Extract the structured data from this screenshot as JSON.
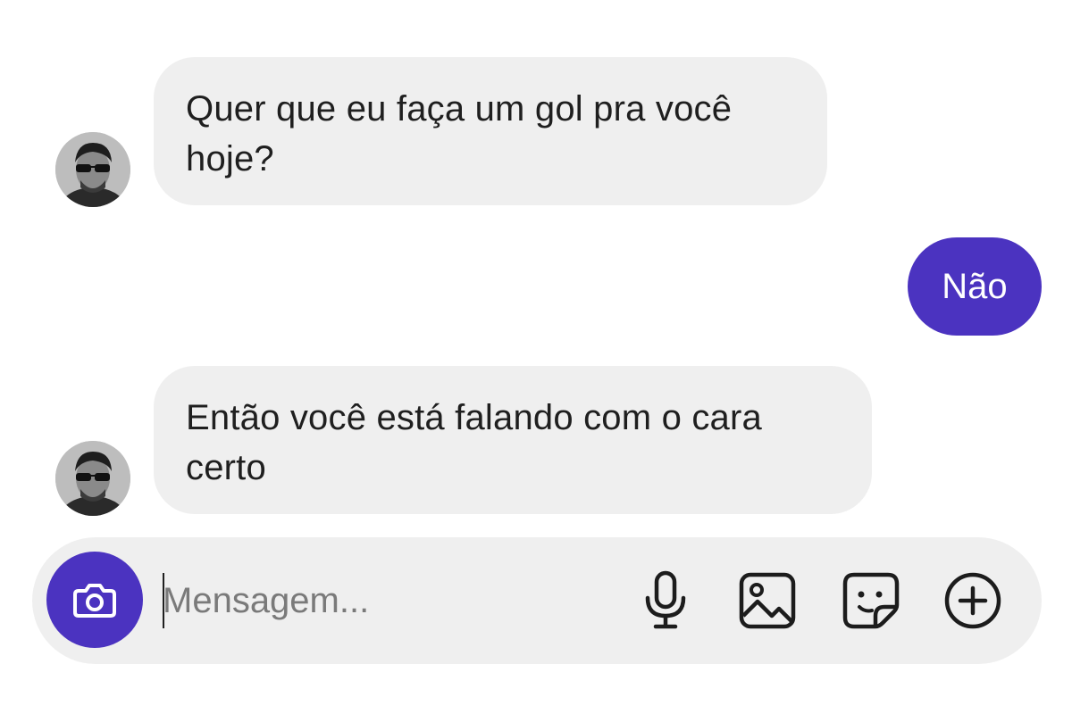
{
  "messages": [
    {
      "direction": "incoming",
      "text": "Quer que eu faça um gol pra você hoje?"
    },
    {
      "direction": "outgoing",
      "text": "Não"
    },
    {
      "direction": "incoming",
      "text": "Então você está falando com o cara certo"
    }
  ],
  "composer": {
    "placeholder": "Mensagem...",
    "icons": [
      "camera-icon",
      "microphone-icon",
      "gallery-icon",
      "sticker-icon",
      "plus-icon"
    ]
  },
  "colors": {
    "accent": "#4b33c0",
    "incoming_bubble": "#efefef",
    "composer_bg": "#efefef",
    "background": "#ffffff"
  }
}
